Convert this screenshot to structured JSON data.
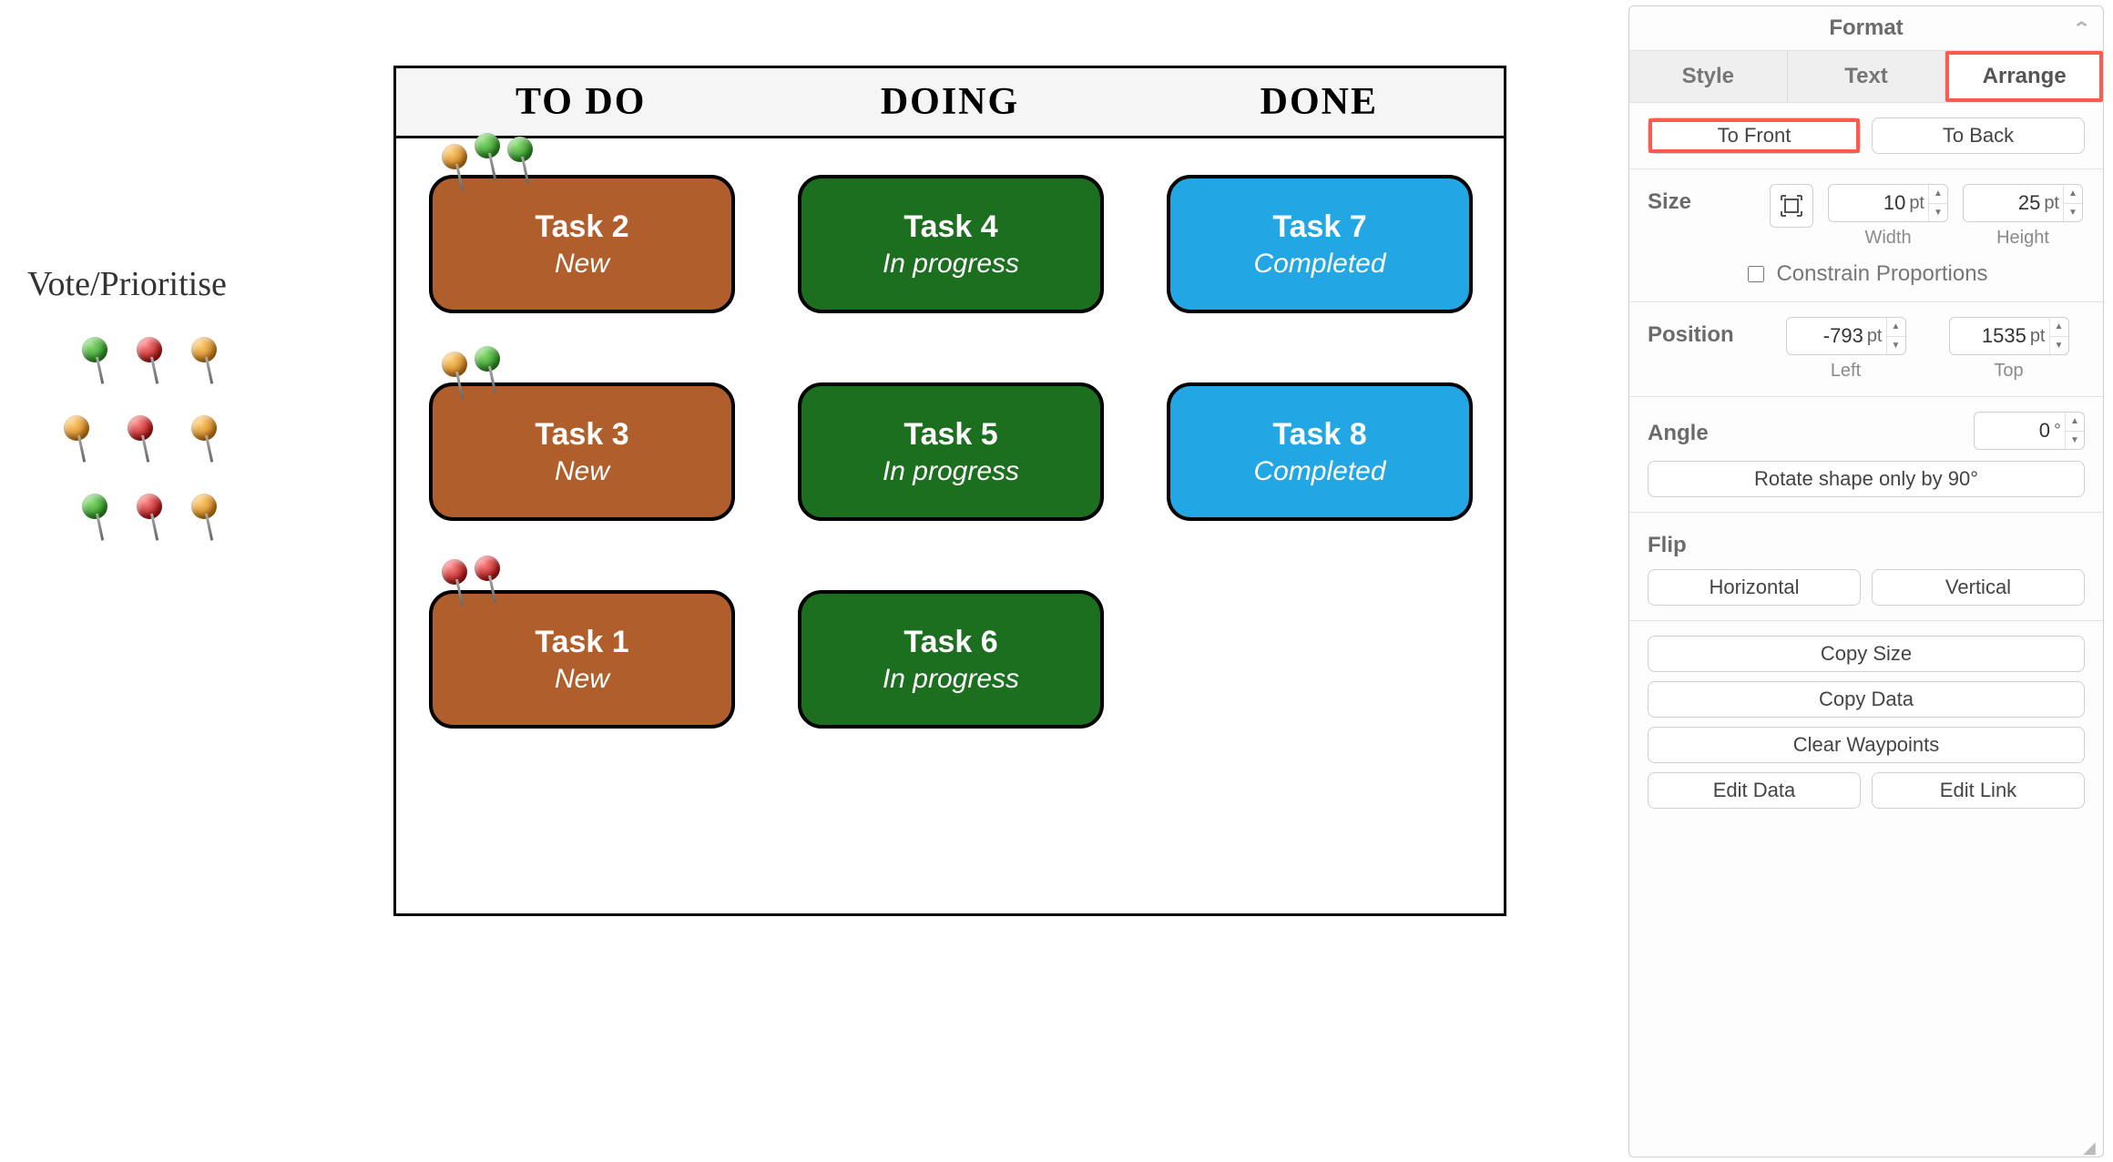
{
  "vote_label": "Vote/Prioritise",
  "pin_palette": [
    [
      "green",
      "red",
      "orange"
    ],
    [
      "orange",
      "red",
      "orange"
    ],
    [
      "green",
      "red",
      "orange"
    ]
  ],
  "board": {
    "columns": [
      "TO DO",
      "DOING",
      "DONE"
    ],
    "cards": {
      "todo": [
        {
          "title": "Task 2",
          "status": "New",
          "pins": [
            "orange",
            "green",
            "green"
          ]
        },
        {
          "title": "Task 3",
          "status": "New",
          "pins": [
            "orange",
            "green"
          ]
        },
        {
          "title": "Task 1",
          "status": "New",
          "pins": [
            "red",
            "red"
          ]
        }
      ],
      "doing": [
        {
          "title": "Task 4",
          "status": "In progress"
        },
        {
          "title": "Task 5",
          "status": "In progress"
        },
        {
          "title": "Task 6",
          "status": "In progress"
        }
      ],
      "done": [
        {
          "title": "Task 7",
          "status": "Completed"
        },
        {
          "title": "Task 8",
          "status": "Completed"
        }
      ]
    }
  },
  "format_panel": {
    "title": "Format",
    "tabs": {
      "style": "Style",
      "text": "Text",
      "arrange": "Arrange"
    },
    "to_front": "To Front",
    "to_back": "To Back",
    "size": {
      "label": "Size",
      "width_value": "10",
      "width_unit": "pt",
      "width_caption": "Width",
      "height_value": "25",
      "height_unit": "pt",
      "height_caption": "Height",
      "constrain": "Constrain Proportions"
    },
    "position": {
      "label": "Position",
      "left_value": "-793",
      "left_unit": "pt",
      "left_caption": "Left",
      "top_value": "1535",
      "top_unit": "pt",
      "top_caption": "Top"
    },
    "angle": {
      "label": "Angle",
      "value": "0",
      "unit": "°",
      "rotate90": "Rotate shape only by 90°"
    },
    "flip": {
      "label": "Flip",
      "horizontal": "Horizontal",
      "vertical": "Vertical"
    },
    "actions": {
      "copy_size": "Copy Size",
      "copy_data": "Copy Data",
      "clear_waypoints": "Clear Waypoints",
      "edit_data": "Edit Data",
      "edit_link": "Edit Link"
    }
  }
}
